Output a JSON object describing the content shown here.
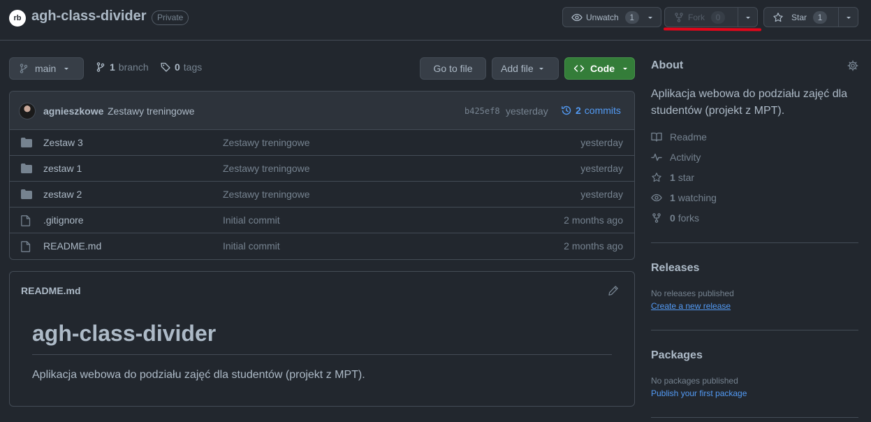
{
  "repo": {
    "owner_avatar_text": "rb",
    "name": "agh-class-divider",
    "visibility": "Private"
  },
  "header_buttons": {
    "watch": {
      "label": "Unwatch",
      "count": "1"
    },
    "fork": {
      "label": "Fork",
      "count": "0"
    },
    "star": {
      "label": "Star",
      "count": "1"
    }
  },
  "toolbar": {
    "branch": "main",
    "branch_count": "1",
    "branch_label": "branch",
    "tag_count": "0",
    "tag_label": "tags",
    "go_to_file": "Go to file",
    "add_file": "Add file",
    "code": "Code"
  },
  "latest_commit": {
    "author": "agnieszkowe",
    "message": "Zestawy treningowe",
    "sha": "b425ef8",
    "time": "yesterday",
    "commit_count": "2",
    "commit_label": "commits"
  },
  "files": [
    {
      "type": "folder",
      "name": "Zestaw 3",
      "message": "Zestawy treningowe",
      "time": "yesterday"
    },
    {
      "type": "folder",
      "name": "zestaw 1",
      "message": "Zestawy treningowe",
      "time": "yesterday"
    },
    {
      "type": "folder",
      "name": "zestaw 2",
      "message": "Zestawy treningowe",
      "time": "yesterday"
    },
    {
      "type": "file",
      "name": ".gitignore",
      "message": "Initial commit",
      "time": "2 months ago"
    },
    {
      "type": "file",
      "name": "README.md",
      "message": "Initial commit",
      "time": "2 months ago"
    }
  ],
  "readme": {
    "filename": "README.md",
    "heading": "agh-class-divider",
    "text": "Aplikacja webowa do podziału zajęć dla studentów (projekt z MPT)."
  },
  "sidebar": {
    "about_title": "About",
    "description": "Aplikacja webowa do podziału zajęć dla studentów (projekt z MPT).",
    "links": {
      "readme": "Readme",
      "activity": "Activity",
      "stars_count": "1",
      "stars_label": "star",
      "watching_count": "1",
      "watching_label": "watching",
      "forks_count": "0",
      "forks_label": "forks"
    },
    "releases": {
      "title": "Releases",
      "empty": "No releases published",
      "link": "Create a new release"
    },
    "packages": {
      "title": "Packages",
      "empty": "No packages published",
      "link": "Publish your first package"
    }
  },
  "colors": {
    "background": "#22272e",
    "border": "#444c56",
    "link": "#539bf5",
    "code_button": "#347d39",
    "annotation": "#e4061a"
  }
}
